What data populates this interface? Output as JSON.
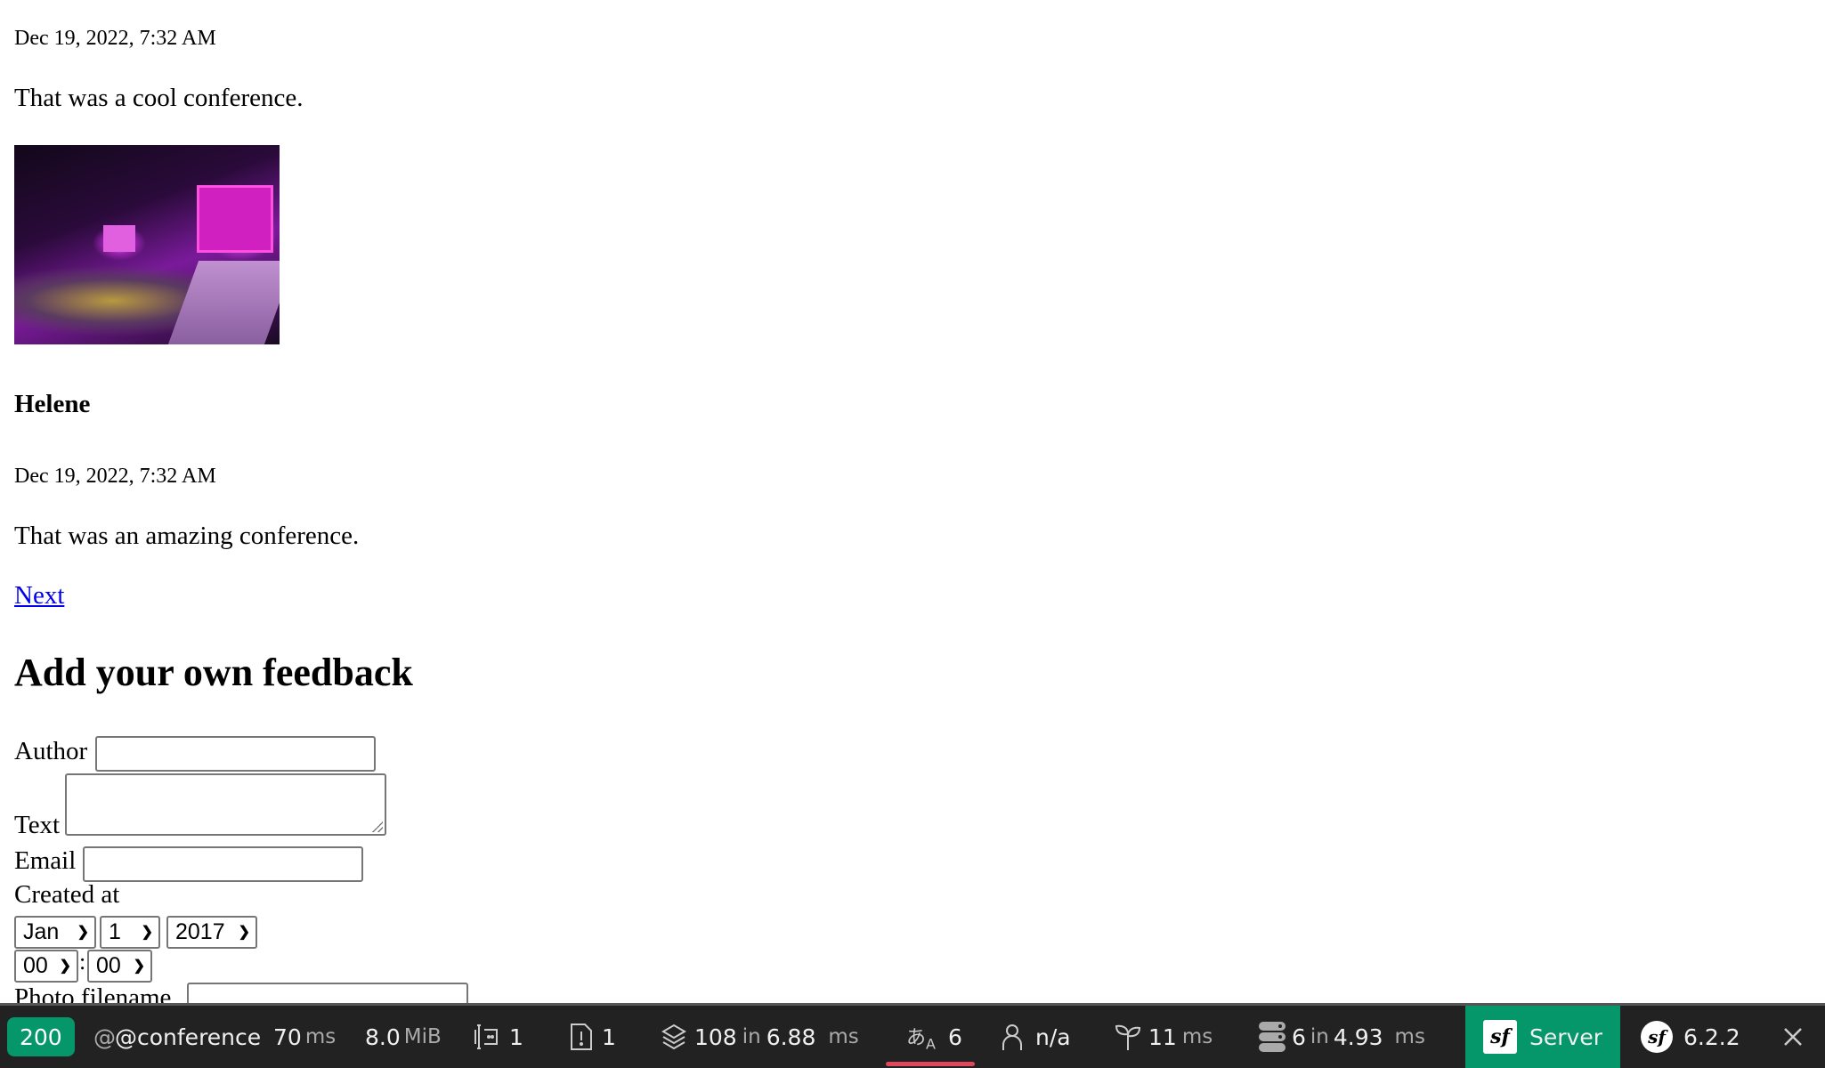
{
  "comments": [
    {
      "date": "Dec 19, 2022, 7:32 AM",
      "text": "That was a cool conference.",
      "has_photo": true
    },
    {
      "author": "Helene",
      "date": "Dec 19, 2022, 7:32 AM",
      "text": "That was an amazing conference."
    }
  ],
  "pagination": {
    "next_label": "Next"
  },
  "form": {
    "title": "Add your own feedback",
    "author_label": "Author",
    "author_value": "",
    "text_label": "Text",
    "text_value": "",
    "email_label": "Email",
    "email_value": "",
    "created_at_label": "Created at",
    "month": "Jan",
    "day": "1",
    "year": "2017",
    "hour": "00",
    "time_separator": ":",
    "minute": "00",
    "photo_label": "Photo filename"
  },
  "toolbar": {
    "status_code": "200",
    "route": "@conference",
    "time_value": "70",
    "time_unit": "ms",
    "memory_value": "8.0",
    "memory_unit": "MiB",
    "forms_count": "1",
    "logs_count": "1",
    "templates_value": "108",
    "templates_in": "in",
    "templates_time": "6.88",
    "templates_unit": "ms",
    "translation_count": "6",
    "user": "n/a",
    "events_value": "11",
    "events_unit": "ms",
    "db_queries": "6",
    "db_in": "in",
    "db_time": "4.93",
    "db_unit": "ms",
    "server_label": "Server",
    "symfony_version": "6.2.2",
    "colors": {
      "background": "#222222",
      "success": "#059669",
      "accent_bar": "#e0475c"
    }
  }
}
